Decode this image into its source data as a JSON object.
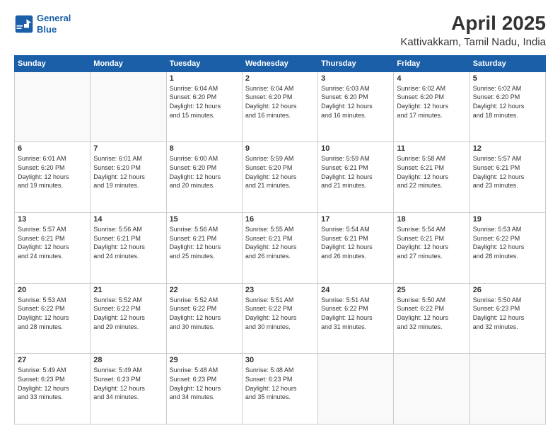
{
  "header": {
    "logo_line1": "General",
    "logo_line2": "Blue",
    "title": "April 2025",
    "subtitle": "Kattivakkam, Tamil Nadu, India"
  },
  "days": [
    "Sunday",
    "Monday",
    "Tuesday",
    "Wednesday",
    "Thursday",
    "Friday",
    "Saturday"
  ],
  "weeks": [
    [
      {
        "num": "",
        "text": ""
      },
      {
        "num": "",
        "text": ""
      },
      {
        "num": "1",
        "text": "Sunrise: 6:04 AM\nSunset: 6:20 PM\nDaylight: 12 hours\nand 15 minutes."
      },
      {
        "num": "2",
        "text": "Sunrise: 6:04 AM\nSunset: 6:20 PM\nDaylight: 12 hours\nand 16 minutes."
      },
      {
        "num": "3",
        "text": "Sunrise: 6:03 AM\nSunset: 6:20 PM\nDaylight: 12 hours\nand 16 minutes."
      },
      {
        "num": "4",
        "text": "Sunrise: 6:02 AM\nSunset: 6:20 PM\nDaylight: 12 hours\nand 17 minutes."
      },
      {
        "num": "5",
        "text": "Sunrise: 6:02 AM\nSunset: 6:20 PM\nDaylight: 12 hours\nand 18 minutes."
      }
    ],
    [
      {
        "num": "6",
        "text": "Sunrise: 6:01 AM\nSunset: 6:20 PM\nDaylight: 12 hours\nand 19 minutes."
      },
      {
        "num": "7",
        "text": "Sunrise: 6:01 AM\nSunset: 6:20 PM\nDaylight: 12 hours\nand 19 minutes."
      },
      {
        "num": "8",
        "text": "Sunrise: 6:00 AM\nSunset: 6:20 PM\nDaylight: 12 hours\nand 20 minutes."
      },
      {
        "num": "9",
        "text": "Sunrise: 5:59 AM\nSunset: 6:20 PM\nDaylight: 12 hours\nand 21 minutes."
      },
      {
        "num": "10",
        "text": "Sunrise: 5:59 AM\nSunset: 6:21 PM\nDaylight: 12 hours\nand 21 minutes."
      },
      {
        "num": "11",
        "text": "Sunrise: 5:58 AM\nSunset: 6:21 PM\nDaylight: 12 hours\nand 22 minutes."
      },
      {
        "num": "12",
        "text": "Sunrise: 5:57 AM\nSunset: 6:21 PM\nDaylight: 12 hours\nand 23 minutes."
      }
    ],
    [
      {
        "num": "13",
        "text": "Sunrise: 5:57 AM\nSunset: 6:21 PM\nDaylight: 12 hours\nand 24 minutes."
      },
      {
        "num": "14",
        "text": "Sunrise: 5:56 AM\nSunset: 6:21 PM\nDaylight: 12 hours\nand 24 minutes."
      },
      {
        "num": "15",
        "text": "Sunrise: 5:56 AM\nSunset: 6:21 PM\nDaylight: 12 hours\nand 25 minutes."
      },
      {
        "num": "16",
        "text": "Sunrise: 5:55 AM\nSunset: 6:21 PM\nDaylight: 12 hours\nand 26 minutes."
      },
      {
        "num": "17",
        "text": "Sunrise: 5:54 AM\nSunset: 6:21 PM\nDaylight: 12 hours\nand 26 minutes."
      },
      {
        "num": "18",
        "text": "Sunrise: 5:54 AM\nSunset: 6:21 PM\nDaylight: 12 hours\nand 27 minutes."
      },
      {
        "num": "19",
        "text": "Sunrise: 5:53 AM\nSunset: 6:22 PM\nDaylight: 12 hours\nand 28 minutes."
      }
    ],
    [
      {
        "num": "20",
        "text": "Sunrise: 5:53 AM\nSunset: 6:22 PM\nDaylight: 12 hours\nand 28 minutes."
      },
      {
        "num": "21",
        "text": "Sunrise: 5:52 AM\nSunset: 6:22 PM\nDaylight: 12 hours\nand 29 minutes."
      },
      {
        "num": "22",
        "text": "Sunrise: 5:52 AM\nSunset: 6:22 PM\nDaylight: 12 hours\nand 30 minutes."
      },
      {
        "num": "23",
        "text": "Sunrise: 5:51 AM\nSunset: 6:22 PM\nDaylight: 12 hours\nand 30 minutes."
      },
      {
        "num": "24",
        "text": "Sunrise: 5:51 AM\nSunset: 6:22 PM\nDaylight: 12 hours\nand 31 minutes."
      },
      {
        "num": "25",
        "text": "Sunrise: 5:50 AM\nSunset: 6:22 PM\nDaylight: 12 hours\nand 32 minutes."
      },
      {
        "num": "26",
        "text": "Sunrise: 5:50 AM\nSunset: 6:23 PM\nDaylight: 12 hours\nand 32 minutes."
      }
    ],
    [
      {
        "num": "27",
        "text": "Sunrise: 5:49 AM\nSunset: 6:23 PM\nDaylight: 12 hours\nand 33 minutes."
      },
      {
        "num": "28",
        "text": "Sunrise: 5:49 AM\nSunset: 6:23 PM\nDaylight: 12 hours\nand 34 minutes."
      },
      {
        "num": "29",
        "text": "Sunrise: 5:48 AM\nSunset: 6:23 PM\nDaylight: 12 hours\nand 34 minutes."
      },
      {
        "num": "30",
        "text": "Sunrise: 5:48 AM\nSunset: 6:23 PM\nDaylight: 12 hours\nand 35 minutes."
      },
      {
        "num": "",
        "text": ""
      },
      {
        "num": "",
        "text": ""
      },
      {
        "num": "",
        "text": ""
      }
    ]
  ]
}
